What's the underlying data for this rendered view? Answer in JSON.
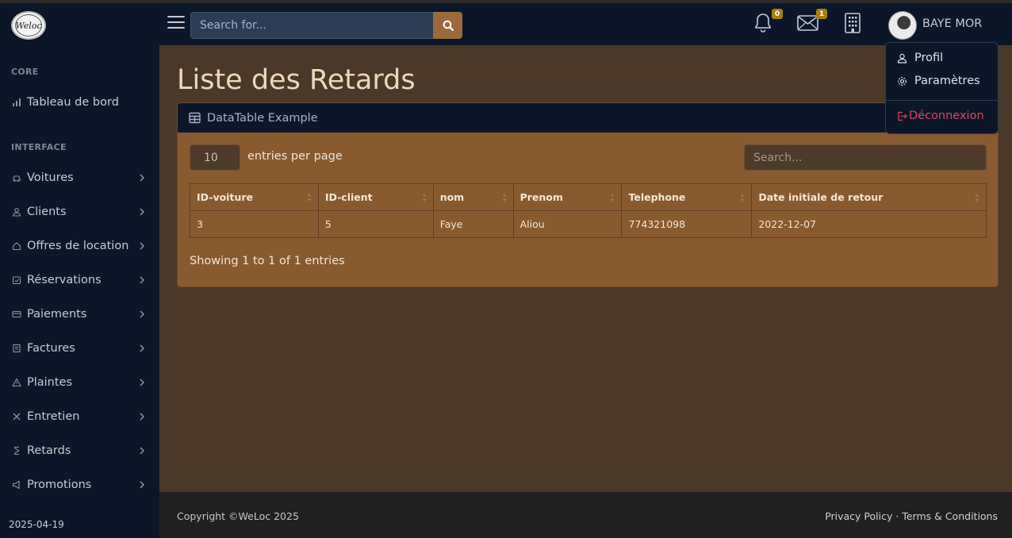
{
  "brand": {
    "logo_text": "Weloc"
  },
  "sidebar": {
    "headings": {
      "core": "CORE",
      "interface": "INTERFACE"
    },
    "dashboard": "Tableau de bord",
    "items": [
      {
        "label": "Voitures",
        "icon": "car-icon"
      },
      {
        "label": "Clients",
        "icon": "user-icon"
      },
      {
        "label": "Offres de location",
        "icon": "home-icon"
      },
      {
        "label": "Réservations",
        "icon": "calendar-check-icon"
      },
      {
        "label": "Paiements",
        "icon": "credit-card-icon"
      },
      {
        "label": "Factures",
        "icon": "receipt-icon"
      },
      {
        "label": "Plaintes",
        "icon": "warning-icon"
      },
      {
        "label": "Entretien",
        "icon": "tools-icon"
      },
      {
        "label": "Retards",
        "icon": "hourglass-icon"
      },
      {
        "label": "Promotions",
        "icon": "megaphone-icon"
      }
    ],
    "footer_date": "2025-04-19"
  },
  "topbar": {
    "search_placeholder": "Search for...",
    "notifications_count": "0",
    "messages_count": "1",
    "user_name": "BAYE MOR"
  },
  "user_menu": {
    "profile": "Profil",
    "settings": "Paramètres",
    "logout": "Déconnexion"
  },
  "main": {
    "page_title": "Liste des Retards",
    "card_title": "DataTable Example",
    "entries_value": "10",
    "entries_label": "entries per page",
    "search_placeholder": "Search...",
    "columns": [
      "ID-voiture",
      "ID-client",
      "nom",
      "Prenom",
      "Telephone",
      "Date initiale de retour"
    ],
    "rows": [
      [
        "3",
        "5",
        "Faye",
        "Aliou",
        "774321098",
        "2022-12-07"
      ]
    ],
    "info": "Showing 1 to 1 of 1 entries"
  },
  "footer": {
    "copyright": "Copyright ©WeLoc 2025",
    "privacy": "Privacy Policy",
    "separator": "·",
    "terms": "Terms & Conditions"
  },
  "colors": {
    "sidebar_bg": "#0c1629",
    "main_bg": "#4a3829",
    "card_bg": "#875a30",
    "accent": "#9c6b3c",
    "badge": "#a87f12",
    "logout": "#d9455f"
  }
}
